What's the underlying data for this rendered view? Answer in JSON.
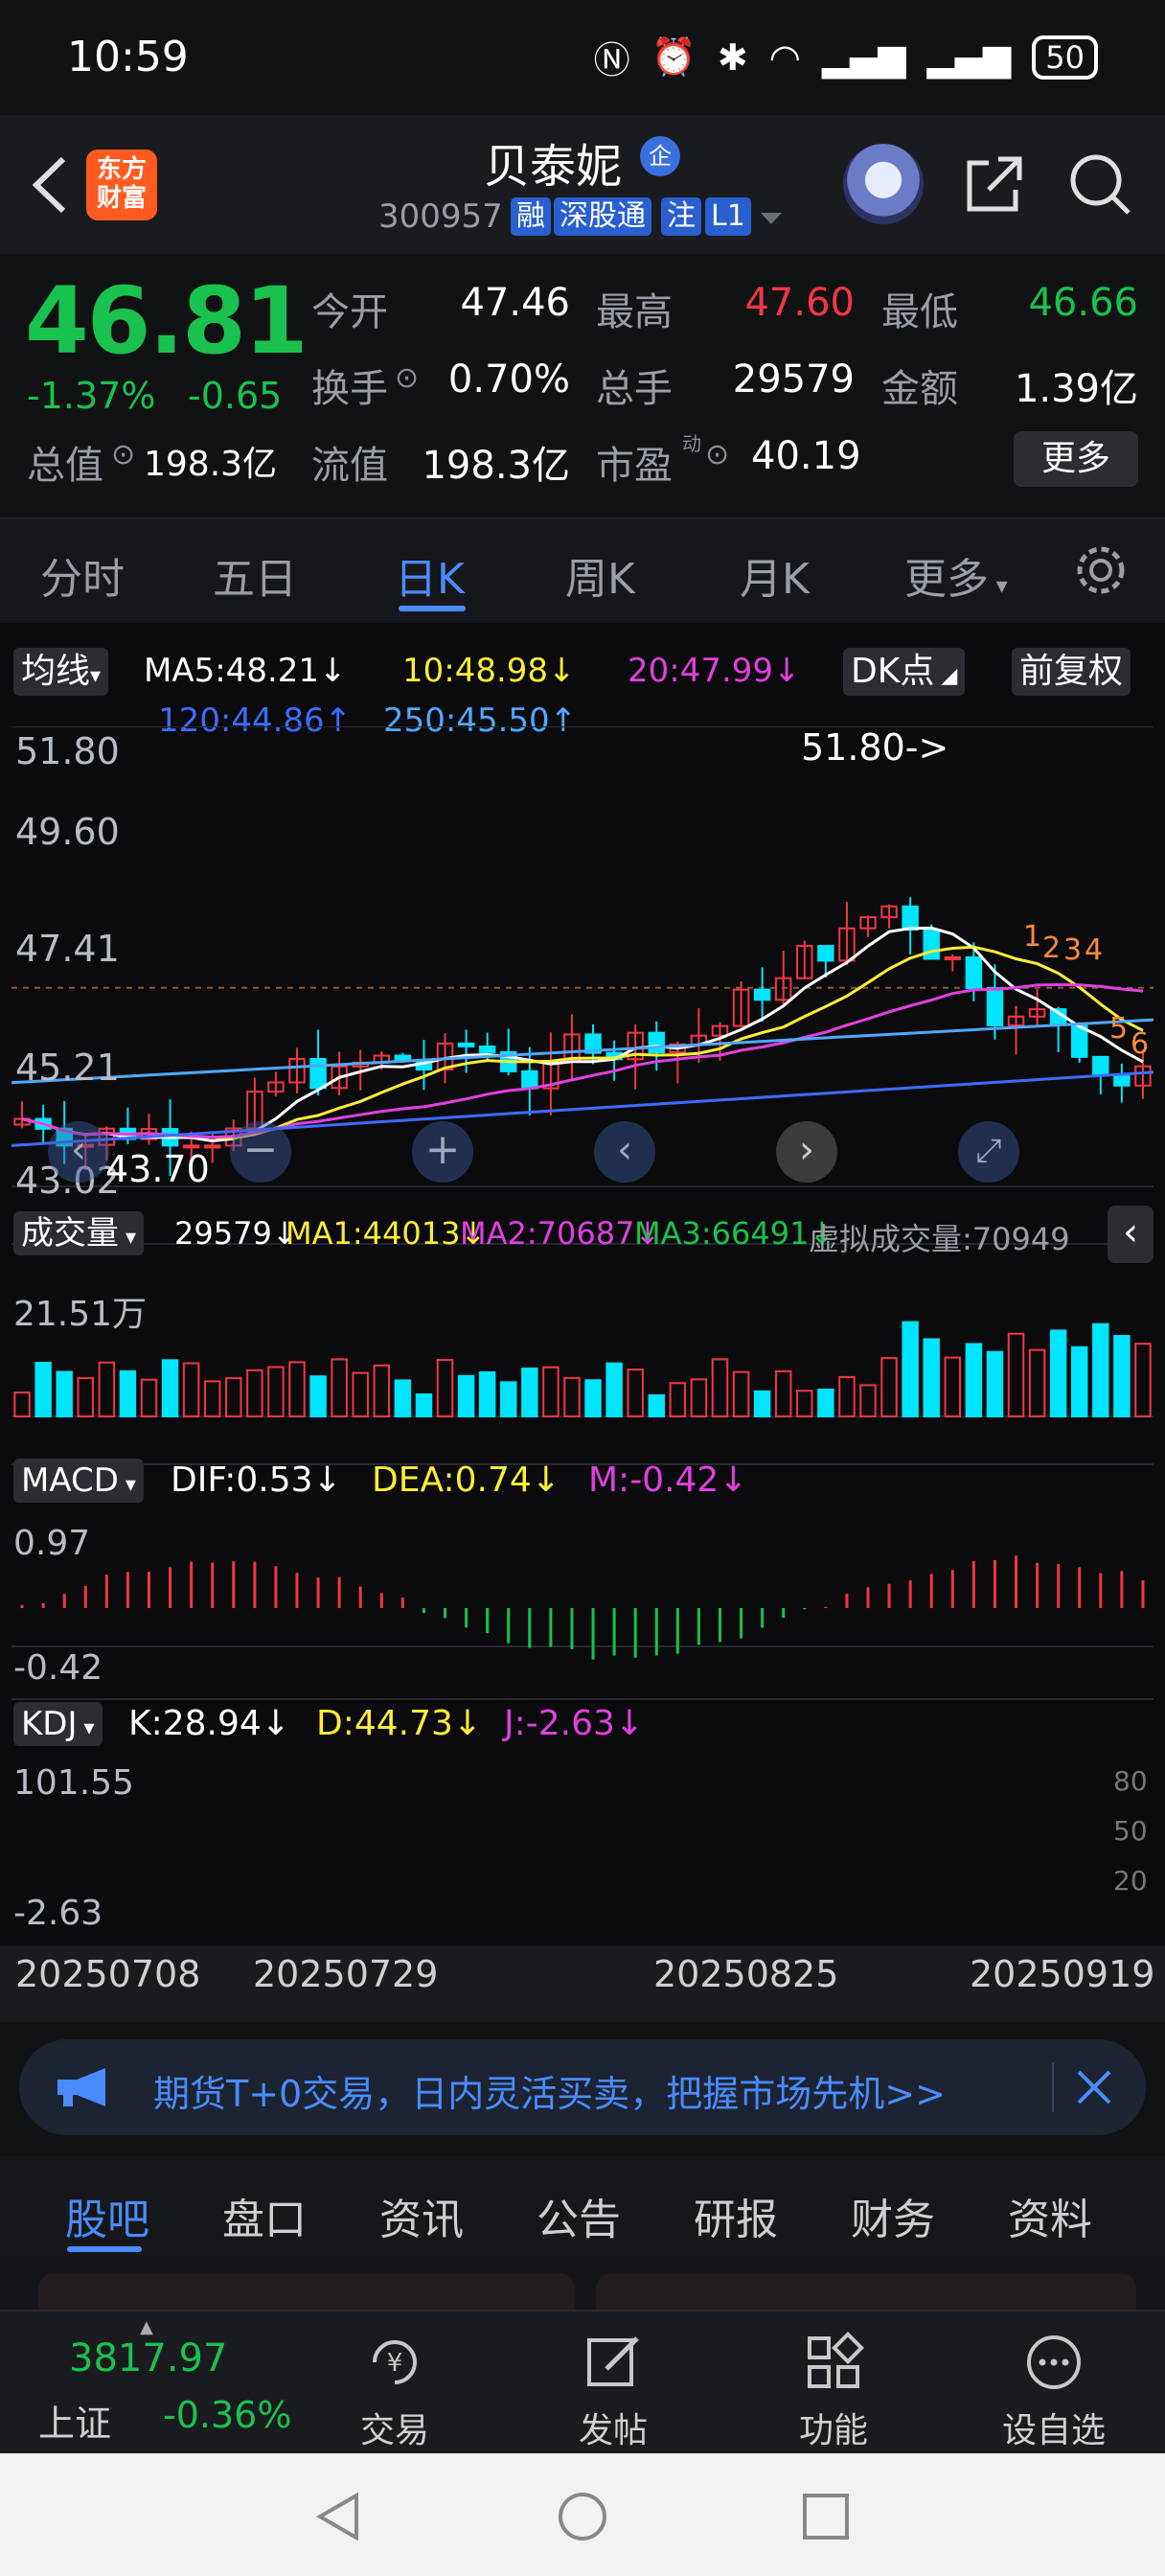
{
  "status_bar": {
    "time": "10:59",
    "battery": "50"
  },
  "header": {
    "logo_line1": "东方",
    "logo_line2": "财富",
    "stock_name": "贝泰妮",
    "enterprise_badge": "企",
    "stock_code": "300957",
    "tags": [
      "融",
      "深股通",
      "注",
      "L1"
    ]
  },
  "quote": {
    "price": "46.81",
    "change_pct": "-1.37%",
    "change_abs": "-0.65",
    "today_open_label": "今开",
    "today_open": "47.46",
    "high_label": "最高",
    "high": "47.60",
    "low_label": "最低",
    "low": "46.66",
    "turnover_label": "换手",
    "turnover": "0.70%",
    "volume_label": "总手",
    "volume": "29579",
    "amount_label": "金额",
    "amount": "1.39亿",
    "total_value_label": "总值",
    "total_value": "198.3亿",
    "float_value_label": "流值",
    "float_value": "198.3亿",
    "pe_label": "市盈",
    "pe_sup": "动",
    "pe": "40.19",
    "more_label": "更多"
  },
  "period_tabs": [
    "分时",
    "五日",
    "日K",
    "周K",
    "月K",
    "更多"
  ],
  "active_period": "日K",
  "chart": {
    "ma_selector": "均线",
    "ma5": "MA5:48.21↓",
    "ma10": "10:48.98↓",
    "ma20": "20:47.99↓",
    "ma120": "120:44.86↑",
    "ma250": "250:45.50↑",
    "dk_button": "DK点",
    "adjust_button": "前复权",
    "price_axis": [
      "51.80",
      "49.60",
      "47.41",
      "45.21",
      "43.02"
    ],
    "high_marker": "51.80->",
    "low_marker": "43.70",
    "volume_selector": "成交量",
    "vol_now": "29579↓",
    "vol_ma1": "MA1:44013↓",
    "vol_ma2": "MA2:70687↓",
    "vol_ma3": "MA3:66491↓",
    "virtual_vol": "虚拟成交量:70949",
    "vol_axis_top": "21.51万",
    "macd_selector": "MACD",
    "macd_dif": "DIF:0.53↓",
    "macd_dea": "DEA:0.74↓",
    "macd_m": "M:-0.42↓",
    "macd_axis_top": "0.97",
    "macd_axis_bottom": "-0.42",
    "kdj_selector": "KDJ",
    "kdj_k": "K:28.94↓",
    "kdj_d": "D:44.73↓",
    "kdj_j": "J:-2.63↓",
    "kdj_axis_top": "101.55",
    "kdj_axis_bottom": "-2.63",
    "kdj_right_levels": [
      "80",
      "50",
      "20"
    ],
    "dates": [
      "20250708",
      "20250729",
      "20250825",
      "20250919"
    ],
    "signal_numbers": [
      "1",
      "2",
      "3",
      "4",
      "5",
      "6"
    ],
    "colors": {
      "up": "#f23645",
      "down": "#00e5ff",
      "ma5": "#ffffff",
      "ma10": "#ffee33",
      "ma20": "#e040e0",
      "ma120": "#3d6cff",
      "ma250": "#4fa8ff"
    }
  },
  "chart_data": {
    "type": "candlestick",
    "x": [
      "20250708",
      "20250729",
      "20250825",
      "20250919"
    ],
    "ylim": [
      43.02,
      51.8
    ],
    "high": 51.8,
    "low": 43.7,
    "last_close": 46.81
  },
  "banner": {
    "text": "期货T+0交易，日内灵活买卖，把握市场先机>>"
  },
  "info_tabs": [
    "股吧",
    "盘口",
    "资讯",
    "公告",
    "研报",
    "财务",
    "资料"
  ],
  "active_info_tab": "股吧",
  "bottom_nav": {
    "index_value": "3817.97",
    "index_name": "上证",
    "index_change": "-0.36%",
    "items": [
      "交易",
      "发帖",
      "功能",
      "设自选"
    ]
  }
}
